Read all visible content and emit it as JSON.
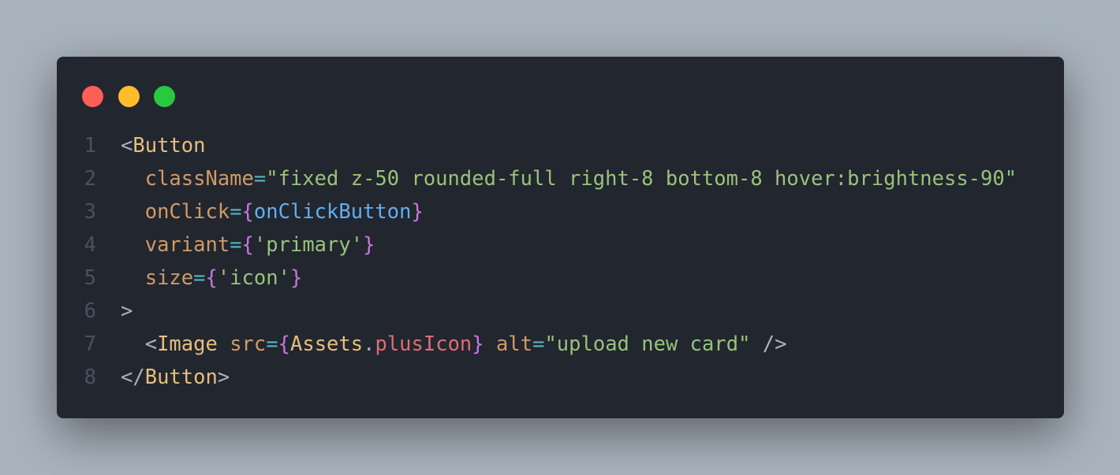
{
  "window": {
    "controls": [
      {
        "name": "close",
        "color": "#ff5f56"
      },
      {
        "name": "minimize",
        "color": "#ffbd2e"
      },
      {
        "name": "maximize",
        "color": "#27c93f"
      }
    ]
  },
  "code": {
    "language": "jsx",
    "lines": [
      {
        "number": "1",
        "tokens": [
          [
            "<",
            "punct"
          ],
          [
            "Button",
            "tag"
          ]
        ]
      },
      {
        "number": "2",
        "tokens": [
          [
            "  ",
            "plain"
          ],
          [
            "className",
            "attr"
          ],
          [
            "=",
            "eq"
          ],
          [
            "\"fixed z-50 rounded-full right-8 bottom-8 hover:brightness-90\"",
            "str"
          ]
        ]
      },
      {
        "number": "3",
        "tokens": [
          [
            "  ",
            "plain"
          ],
          [
            "onClick",
            "attr"
          ],
          [
            "=",
            "eq"
          ],
          [
            "{",
            "brace"
          ],
          [
            "onClickButton",
            "var"
          ],
          [
            "}",
            "brace"
          ]
        ]
      },
      {
        "number": "4",
        "tokens": [
          [
            "  ",
            "plain"
          ],
          [
            "variant",
            "attr"
          ],
          [
            "=",
            "eq"
          ],
          [
            "{",
            "brace"
          ],
          [
            "'primary'",
            "str"
          ],
          [
            "}",
            "brace"
          ]
        ]
      },
      {
        "number": "5",
        "tokens": [
          [
            "  ",
            "plain"
          ],
          [
            "size",
            "attr"
          ],
          [
            "=",
            "eq"
          ],
          [
            "{",
            "brace"
          ],
          [
            "'icon'",
            "str"
          ],
          [
            "}",
            "brace"
          ]
        ]
      },
      {
        "number": "6",
        "tokens": [
          [
            ">",
            "punct"
          ]
        ]
      },
      {
        "number": "7",
        "tokens": [
          [
            "  ",
            "plain"
          ],
          [
            "<",
            "punct"
          ],
          [
            "Image",
            "tag"
          ],
          [
            " ",
            "plain"
          ],
          [
            "src",
            "attr"
          ],
          [
            "=",
            "eq"
          ],
          [
            "{",
            "brace"
          ],
          [
            "Assets",
            "tag"
          ],
          [
            ".",
            "punct"
          ],
          [
            "plusIcon",
            "prop"
          ],
          [
            "}",
            "brace"
          ],
          [
            " ",
            "plain"
          ],
          [
            "alt",
            "attr"
          ],
          [
            "=",
            "eq"
          ],
          [
            "\"upload new card\"",
            "str"
          ],
          [
            " />",
            "punct"
          ]
        ]
      },
      {
        "number": "8",
        "tokens": [
          [
            "</",
            "punct"
          ],
          [
            "Button",
            "tag"
          ],
          [
            ">",
            "punct"
          ]
        ]
      }
    ]
  }
}
